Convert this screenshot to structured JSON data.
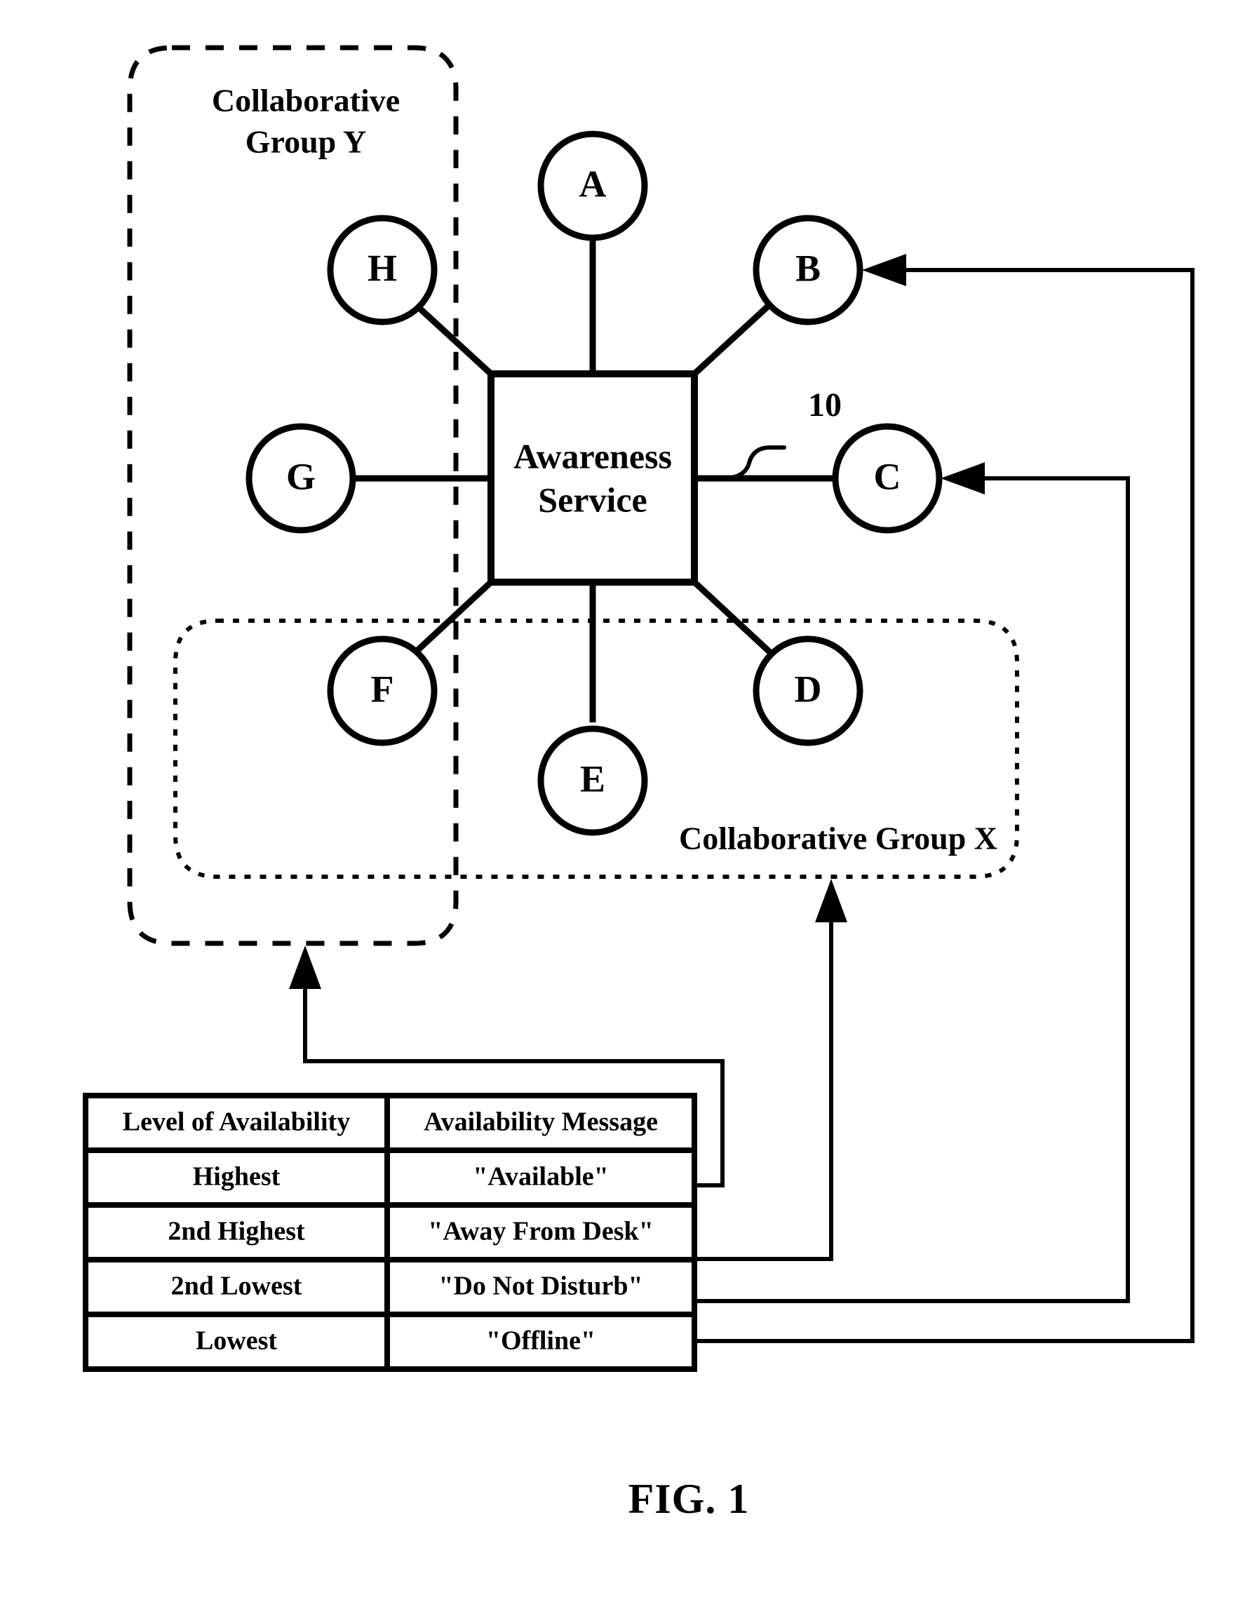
{
  "figure": {
    "caption": "FIG. 1",
    "reference_numeral": "10"
  },
  "central_box": {
    "label_line1": "Awareness",
    "label_line2": "Service"
  },
  "groups": [
    {
      "id": "Y",
      "label_line1": "Collaborative",
      "label_line2": "Group Y",
      "border_style": "dashed"
    },
    {
      "id": "X",
      "label": "Collaborative Group X",
      "border_style": "dotted"
    }
  ],
  "nodes": [
    {
      "id": "A",
      "label": "A"
    },
    {
      "id": "B",
      "label": "B"
    },
    {
      "id": "C",
      "label": "C"
    },
    {
      "id": "D",
      "label": "D"
    },
    {
      "id": "E",
      "label": "E"
    },
    {
      "id": "F",
      "label": "F"
    },
    {
      "id": "G",
      "label": "G"
    },
    {
      "id": "H",
      "label": "H"
    }
  ],
  "table": {
    "headers": [
      "Level of Availability",
      "Availability Message"
    ],
    "rows": [
      {
        "level": "Highest",
        "message": "\"Available\""
      },
      {
        "level": "2nd Highest",
        "message": "\"Away From Desk\""
      },
      {
        "level": "2nd Lowest",
        "message": "\"Do Not Disturb\""
      },
      {
        "level": "Lowest",
        "message": "\"Offline\""
      }
    ]
  },
  "colors": {
    "ink": "#000000",
    "paper": "#ffffff"
  }
}
